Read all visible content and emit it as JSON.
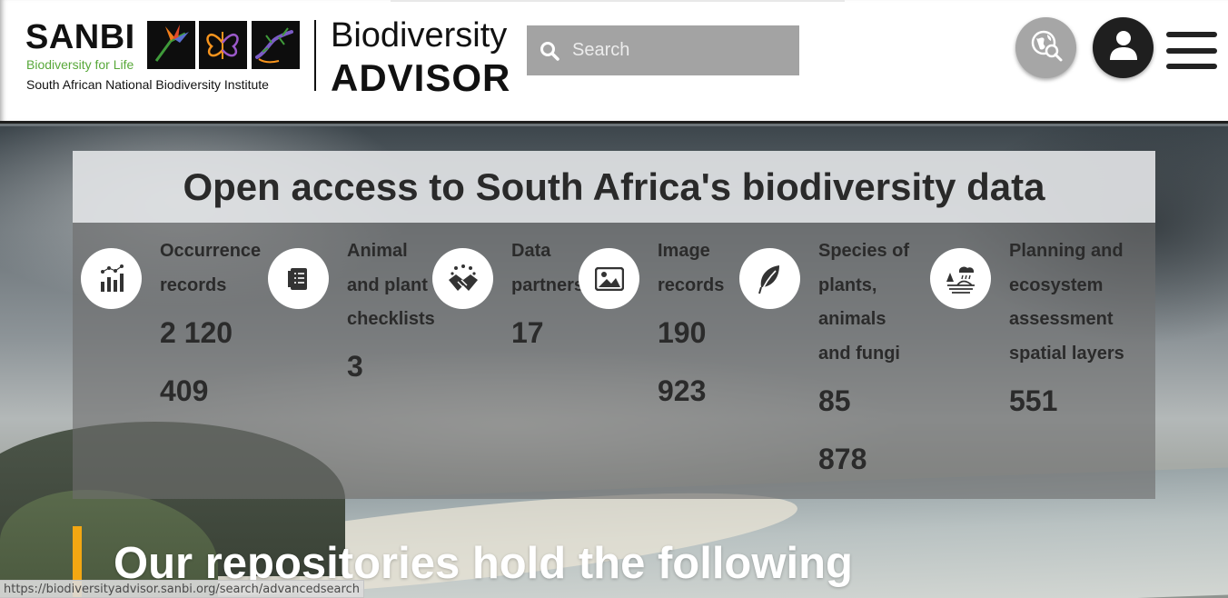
{
  "header": {
    "logo": {
      "org_short": "SANBI",
      "org_tagline": "Biodiversity for Life",
      "org_full": "South African National Biodiversity Institute",
      "product_line1": "Biodiversity",
      "product_line2": "ADVISOR"
    },
    "search": {
      "placeholder": "Search",
      "value": ""
    },
    "buttons": {
      "explore_icon": "globe-search-icon",
      "user_icon": "user-icon",
      "menu_icon": "hamburger-menu-icon"
    }
  },
  "hero": {
    "title": "Open access to South Africa's biodiversity data",
    "stats": [
      {
        "label": "Occurrence records",
        "value": "2 120 409",
        "icon": "bar-chart-icon"
      },
      {
        "label": "Animal and plant checklists",
        "value": "3",
        "icon": "checklist-icon"
      },
      {
        "label": "Data partners",
        "value": "17",
        "icon": "handshake-icon"
      },
      {
        "label": "Image records",
        "value": "190 923",
        "icon": "image-icon"
      },
      {
        "label": "Species of plants, animals and fungi",
        "value": "85 878",
        "icon": "leaf-icon"
      },
      {
        "label": "Planning and ecosystem assessment spatial layers",
        "value": "551",
        "icon": "landscape-rain-icon"
      }
    ],
    "repositories_heading": "Our repositories hold the following"
  },
  "status_bar": {
    "url": "https://biodiversityadvisor.sanbi.org/search/advancedsearch"
  },
  "colors": {
    "accent_bar": "#f3a712",
    "search_bg": "#a3a3a3",
    "header_bg": "#ffffff"
  }
}
